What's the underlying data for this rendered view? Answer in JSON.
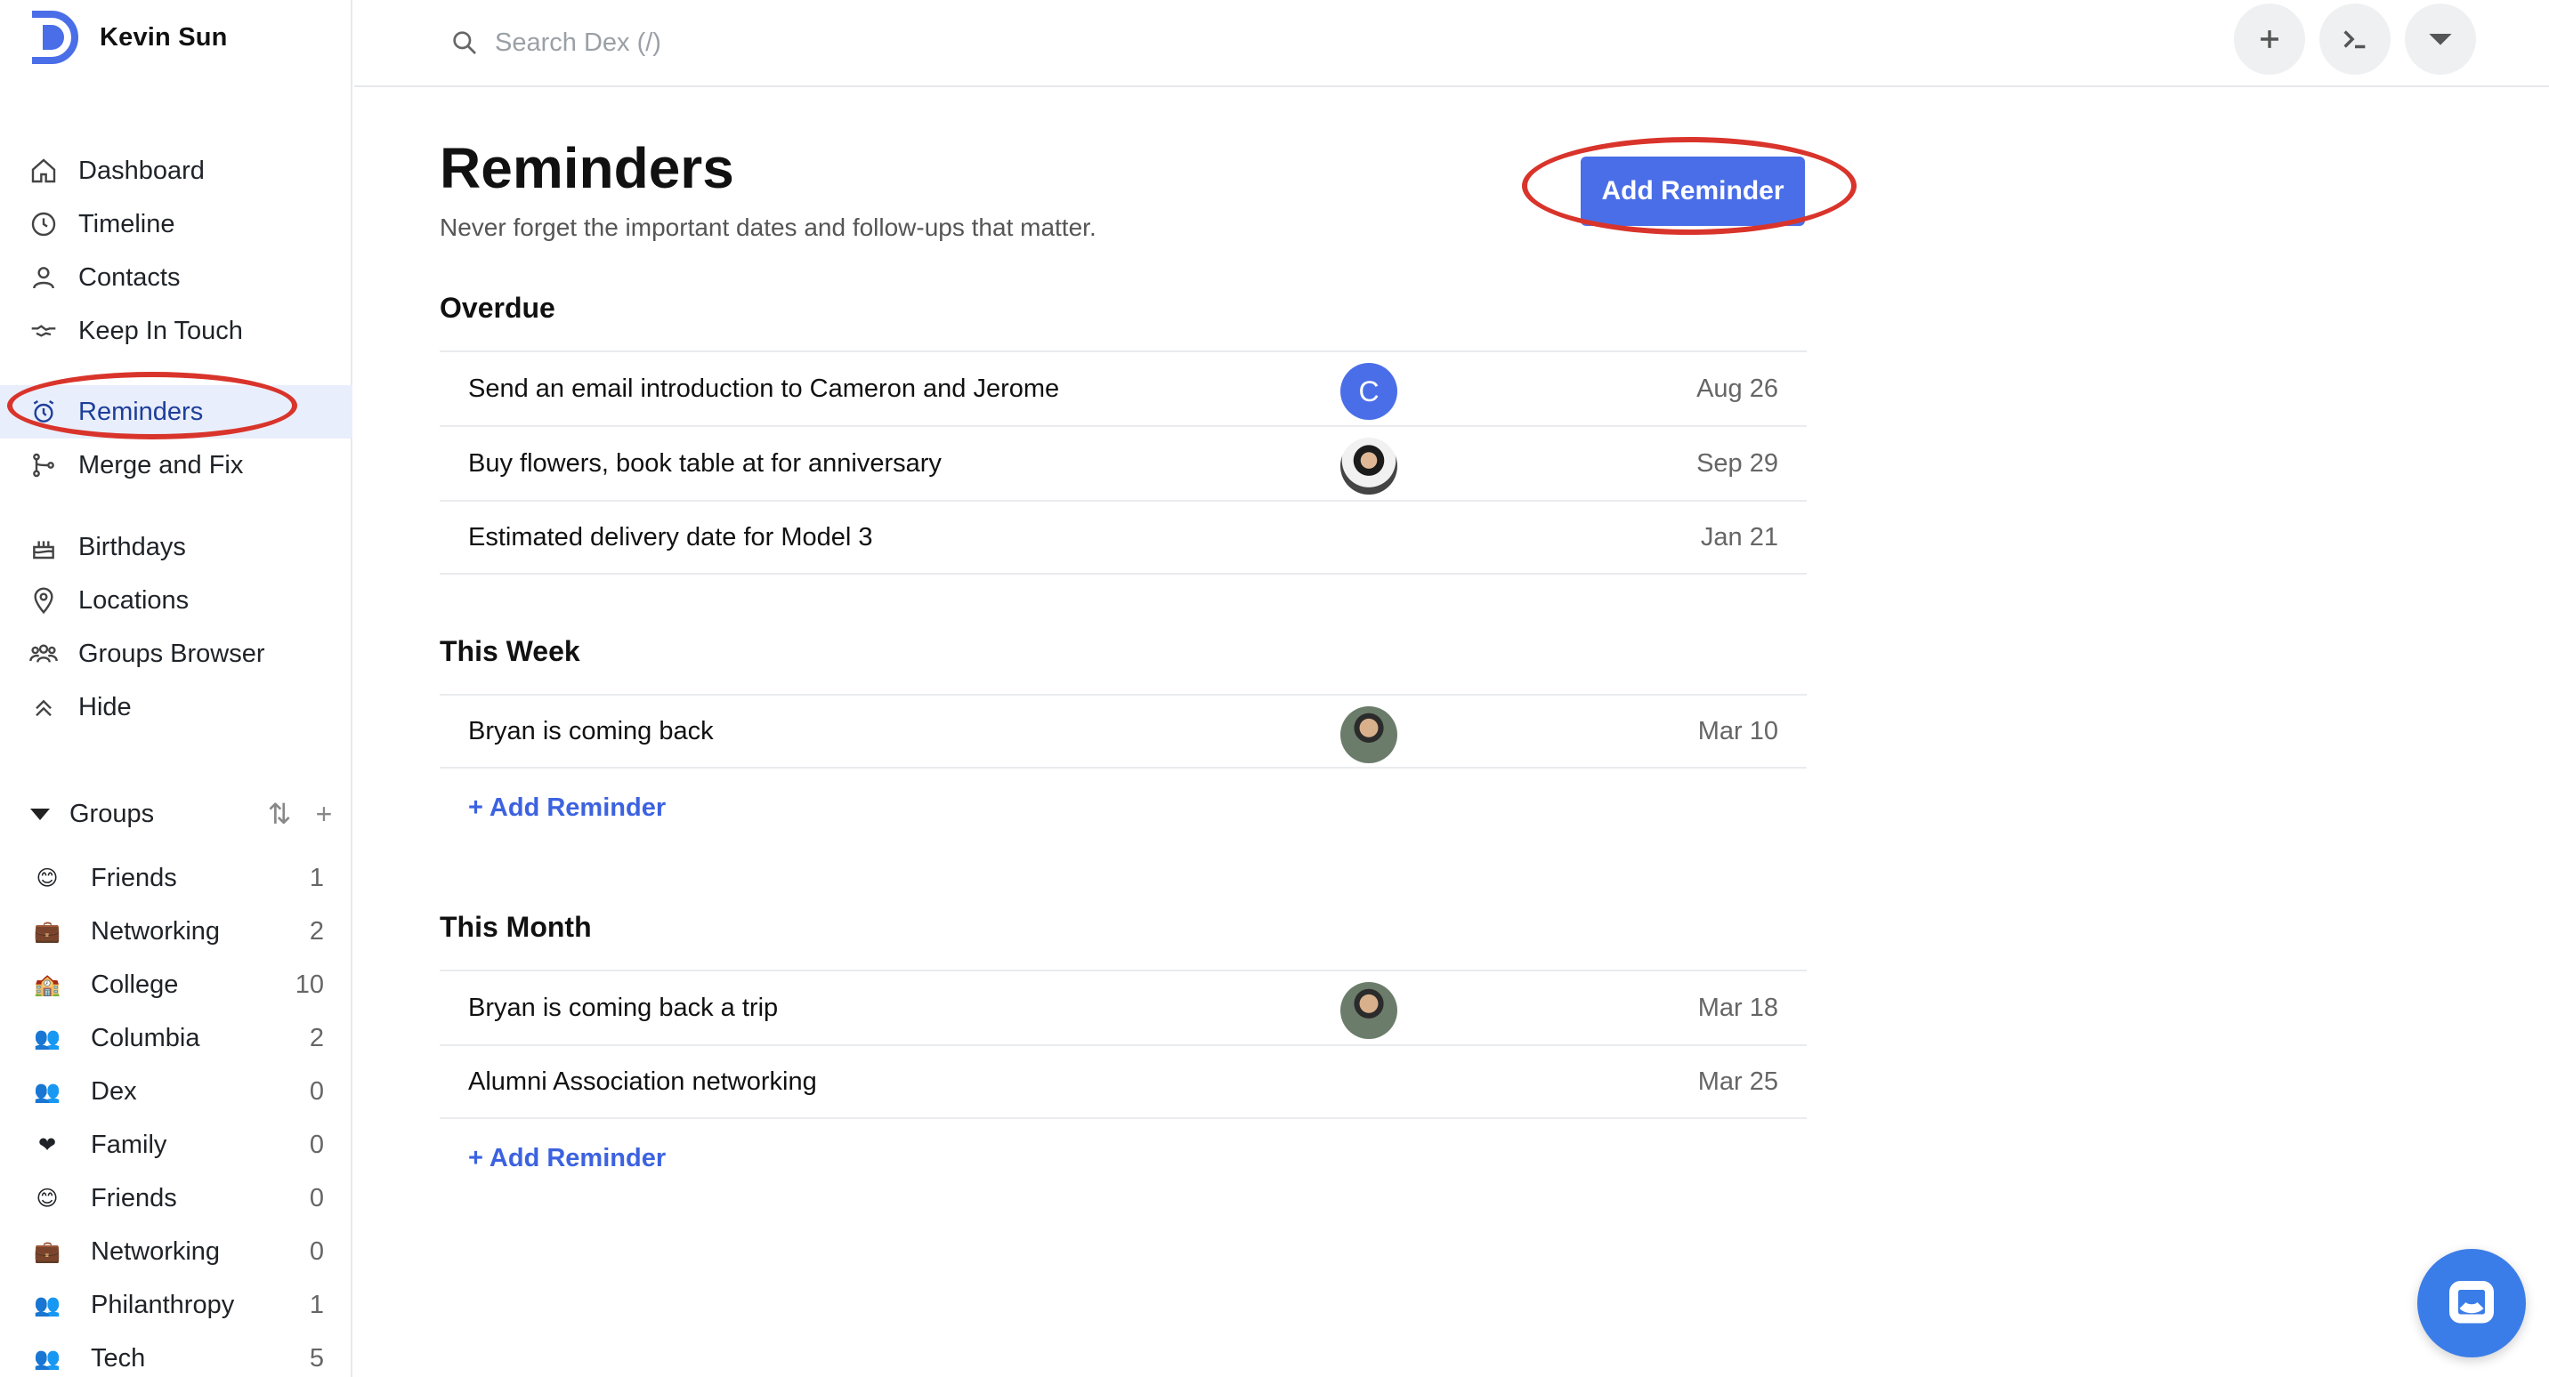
{
  "user": {
    "name": "Kevin Sun"
  },
  "search": {
    "placeholder": "Search Dex (/)"
  },
  "nav": {
    "primary": [
      {
        "label": "Dashboard",
        "icon": "home-icon"
      },
      {
        "label": "Timeline",
        "icon": "clock-icon"
      },
      {
        "label": "Contacts",
        "icon": "person-icon"
      },
      {
        "label": "Keep In Touch",
        "icon": "handshake-icon"
      },
      {
        "label": "Reminders",
        "icon": "alarm-icon",
        "active": true
      },
      {
        "label": "Merge and Fix",
        "icon": "merge-icon"
      }
    ],
    "secondary": [
      {
        "label": "Birthdays",
        "icon": "cake-icon"
      },
      {
        "label": "Locations",
        "icon": "pin-icon"
      },
      {
        "label": "Groups Browser",
        "icon": "people-icon"
      },
      {
        "label": "Hide",
        "icon": "chevrons-up-icon"
      }
    ]
  },
  "groups": {
    "title": "Groups",
    "items": [
      {
        "emoji": "😊",
        "name": "Friends",
        "count": "1"
      },
      {
        "emoji": "💼",
        "name": "Networking",
        "count": "2"
      },
      {
        "emoji": "🏫",
        "name": "College",
        "count": "10"
      },
      {
        "emoji": "👥",
        "name": "Columbia",
        "count": "2"
      },
      {
        "emoji": "👥",
        "name": "Dex",
        "count": "0"
      },
      {
        "emoji": "❤",
        "name": "Family",
        "count": "0"
      },
      {
        "emoji": "😊",
        "name": "Friends",
        "count": "0"
      },
      {
        "emoji": "💼",
        "name": "Networking",
        "count": "0"
      },
      {
        "emoji": "👥",
        "name": "Philanthropy",
        "count": "1"
      },
      {
        "emoji": "👥",
        "name": "Tech",
        "count": "5"
      }
    ]
  },
  "page": {
    "title": "Reminders",
    "subtitle": "Never forget the important dates and follow-ups that matter.",
    "add_button": "Add Reminder",
    "add_link": "+ Add Reminder"
  },
  "sections": {
    "overdue": {
      "title": "Overdue",
      "rows": [
        {
          "title": "Send an email introduction to Cameron and Jerome",
          "date": "Aug 26",
          "avatar": "C"
        },
        {
          "title": "Buy flowers, book table at for anniversary",
          "date": "Sep 29"
        },
        {
          "title": "Estimated delivery date for Model 3",
          "date": "Jan 21"
        }
      ]
    },
    "this_week": {
      "title": "This Week",
      "rows": [
        {
          "title": "Bryan is coming back",
          "date": "Mar 10"
        }
      ]
    },
    "this_month": {
      "title": "This Month",
      "rows": [
        {
          "title": "Bryan is coming back a trip",
          "date": "Mar 18"
        },
        {
          "title": "Alumni Association networking",
          "date": "Mar 25"
        }
      ]
    }
  },
  "colors": {
    "accent": "#4a6ee8",
    "annotation": "#d9342b",
    "active_bg": "#e9eefc"
  }
}
